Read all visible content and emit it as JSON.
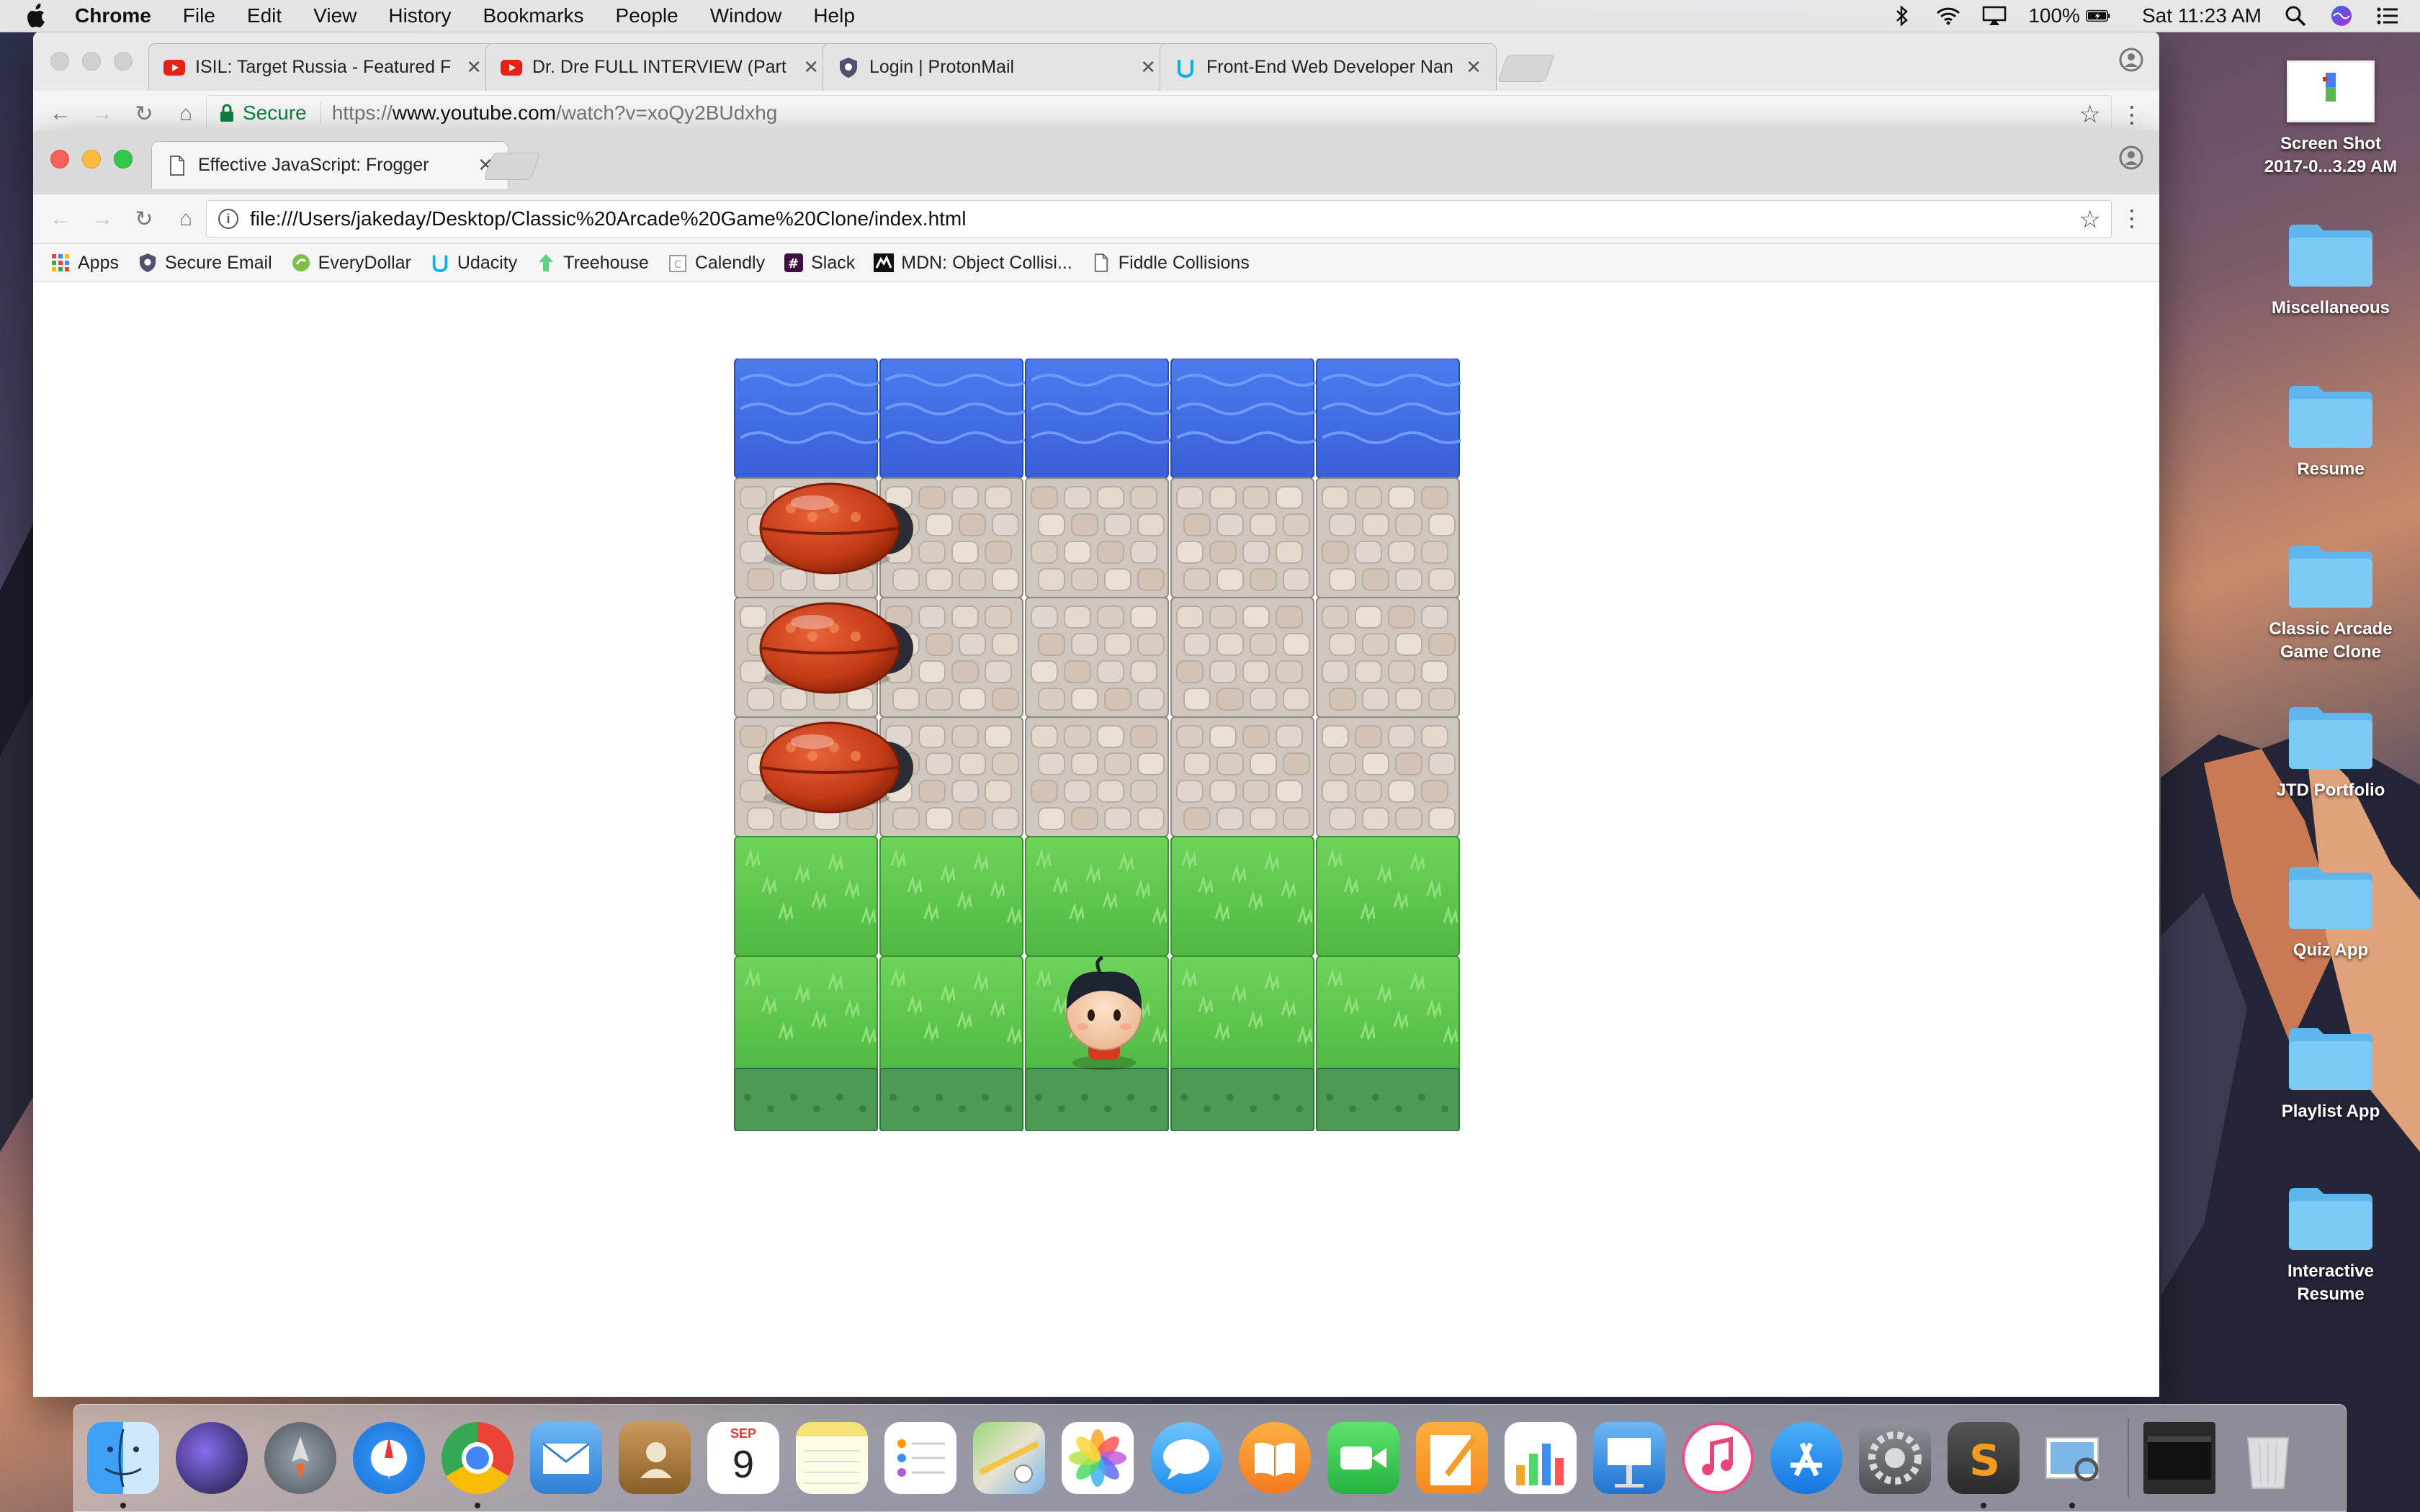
{
  "menubar": {
    "app_name": "Chrome",
    "menus": [
      "File",
      "Edit",
      "View",
      "History",
      "Bookmarks",
      "People",
      "Window",
      "Help"
    ],
    "battery": "100%",
    "clock": "Sat 11:23 AM"
  },
  "back_window": {
    "tabs": [
      {
        "title": "ISIL: Target Russia - Featured F",
        "favicon": "youtube-icon"
      },
      {
        "title": "Dr. Dre FULL INTERVIEW (Part",
        "favicon": "youtube-icon"
      },
      {
        "title": "Login | ProtonMail",
        "favicon": "protonmail-icon"
      },
      {
        "title": "Front-End Web Developer Nan",
        "favicon": "udacity-icon"
      }
    ],
    "secure_label": "Secure",
    "url_scheme": "https://",
    "url_host": "www.youtube.com",
    "url_path": "/watch?v=xoQy2BUdxhg"
  },
  "front_window": {
    "tab_title": "Effective JavaScript: Frogger",
    "url": "file:///Users/jakeday/Desktop/Classic%20Arcade%20Game%20Clone/index.html",
    "bookmarks": [
      {
        "label": "Apps",
        "icon": "apps-grid-icon"
      },
      {
        "label": "Secure Email",
        "icon": "protonmail-icon"
      },
      {
        "label": "EveryDollar",
        "icon": "everydollar-icon"
      },
      {
        "label": "Udacity",
        "icon": "udacity-icon"
      },
      {
        "label": "Treehouse",
        "icon": "treehouse-icon"
      },
      {
        "label": "Calendly",
        "icon": "calendly-icon"
      },
      {
        "label": "Slack",
        "icon": "slack-icon"
      },
      {
        "label": "MDN: Object Collisi...",
        "icon": "mdn-icon"
      },
      {
        "label": "Fiddle Collisions",
        "icon": "page-icon"
      }
    ]
  },
  "game": {
    "columns": 5,
    "rows": [
      "water",
      "stone",
      "stone",
      "stone",
      "grass",
      "grass"
    ],
    "enemies": [
      {
        "type": "bug",
        "row": 1,
        "col": 0
      },
      {
        "type": "bug",
        "row": 2,
        "col": 0
      },
      {
        "type": "bug",
        "row": 3,
        "col": 0
      }
    ],
    "player": {
      "type": "boy",
      "row": 5,
      "col": 2
    }
  },
  "desktop": {
    "items": [
      {
        "label": "Screen Shot 2017-0...3.29 AM",
        "type": "screenshot"
      },
      {
        "label": "Miscellaneous",
        "type": "folder"
      },
      {
        "label": "Resume",
        "type": "folder"
      },
      {
        "label": "Classic Arcade Game Clone",
        "type": "folder"
      },
      {
        "label": "JTD Portfolio",
        "type": "folder"
      },
      {
        "label": "Quiz App",
        "type": "folder"
      },
      {
        "label": "Playlist App",
        "type": "folder"
      },
      {
        "label": "Interactive Resume",
        "type": "folder"
      }
    ]
  },
  "dock": {
    "apps": [
      "finder-icon",
      "siri-icon",
      "launchpad-icon",
      "safari-icon",
      "chrome-icon",
      "mail-icon",
      "contacts-icon",
      "calendar-icon",
      "notes-icon",
      "reminders-icon",
      "maps-icon",
      "photos-icon",
      "messages-icon",
      "ibooks-icon",
      "facetime-icon",
      "pages-icon",
      "numbers-icon",
      "keynote-icon",
      "itunes-icon",
      "app-store-icon",
      "system-preferences-icon",
      "sublime-text-icon",
      "preview-icon"
    ],
    "calendar_month": "SEP",
    "calendar_day": "9"
  }
}
